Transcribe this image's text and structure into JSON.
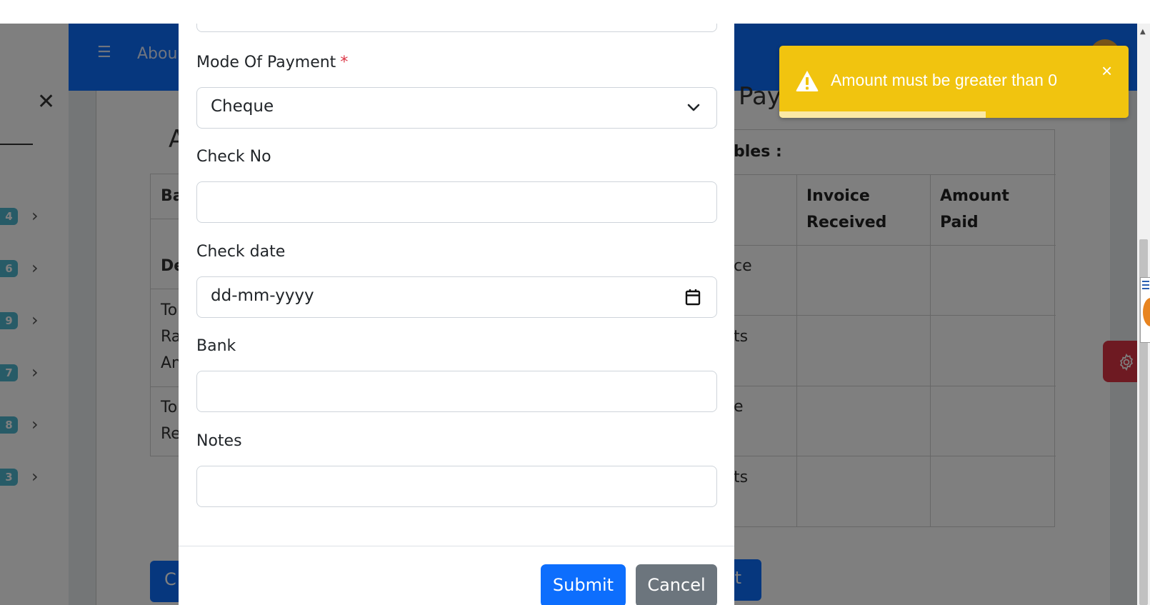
{
  "background": {
    "header_about": "Abou",
    "left_table_fragments": [
      "Ba",
      "De",
      "To",
      "Ra",
      "An",
      "To",
      "Re"
    ],
    "page_heading_fragment": "A",
    "page_heading_right_fragment": "Pay",
    "sidebar_badges": [
      "4",
      "6",
      "9",
      "7",
      "8",
      "3"
    ],
    "right_table": {
      "caption_fragment": "bles :",
      "headers": [
        "Invoice Received",
        "Amount Paid"
      ],
      "row_fragments": [
        "ce",
        "ts",
        "e",
        "ts"
      ]
    },
    "button_left_fragment": "C",
    "button_right_fragment": "ot"
  },
  "modal": {
    "mode_of_payment": {
      "label": "Mode Of Payment",
      "required_mark": "*",
      "value": "Cheque"
    },
    "check_no": {
      "label": "Check No",
      "value": ""
    },
    "check_date": {
      "label": "Check date",
      "value": "dd-mm-yyyy"
    },
    "bank": {
      "label": "Bank",
      "value": ""
    },
    "notes": {
      "label": "Notes",
      "value": ""
    },
    "submit_label": "Submit",
    "cancel_label": "Cancel"
  },
  "toast": {
    "message": "Amount must be greater than 0",
    "close": "×",
    "progress_fraction": 0.59
  },
  "colors": {
    "primary": "#0d6efd",
    "secondary": "#6c757d",
    "warning": "#f1c40f",
    "danger": "#dc3545",
    "badge": "#4fb6cf"
  },
  "icons": {
    "sidebar_close": "close-icon",
    "menu": "hamburger-icon",
    "select": "chevron-down-icon",
    "date": "calendar-icon",
    "toast": "warning-icon",
    "fab": "gear-icon"
  }
}
